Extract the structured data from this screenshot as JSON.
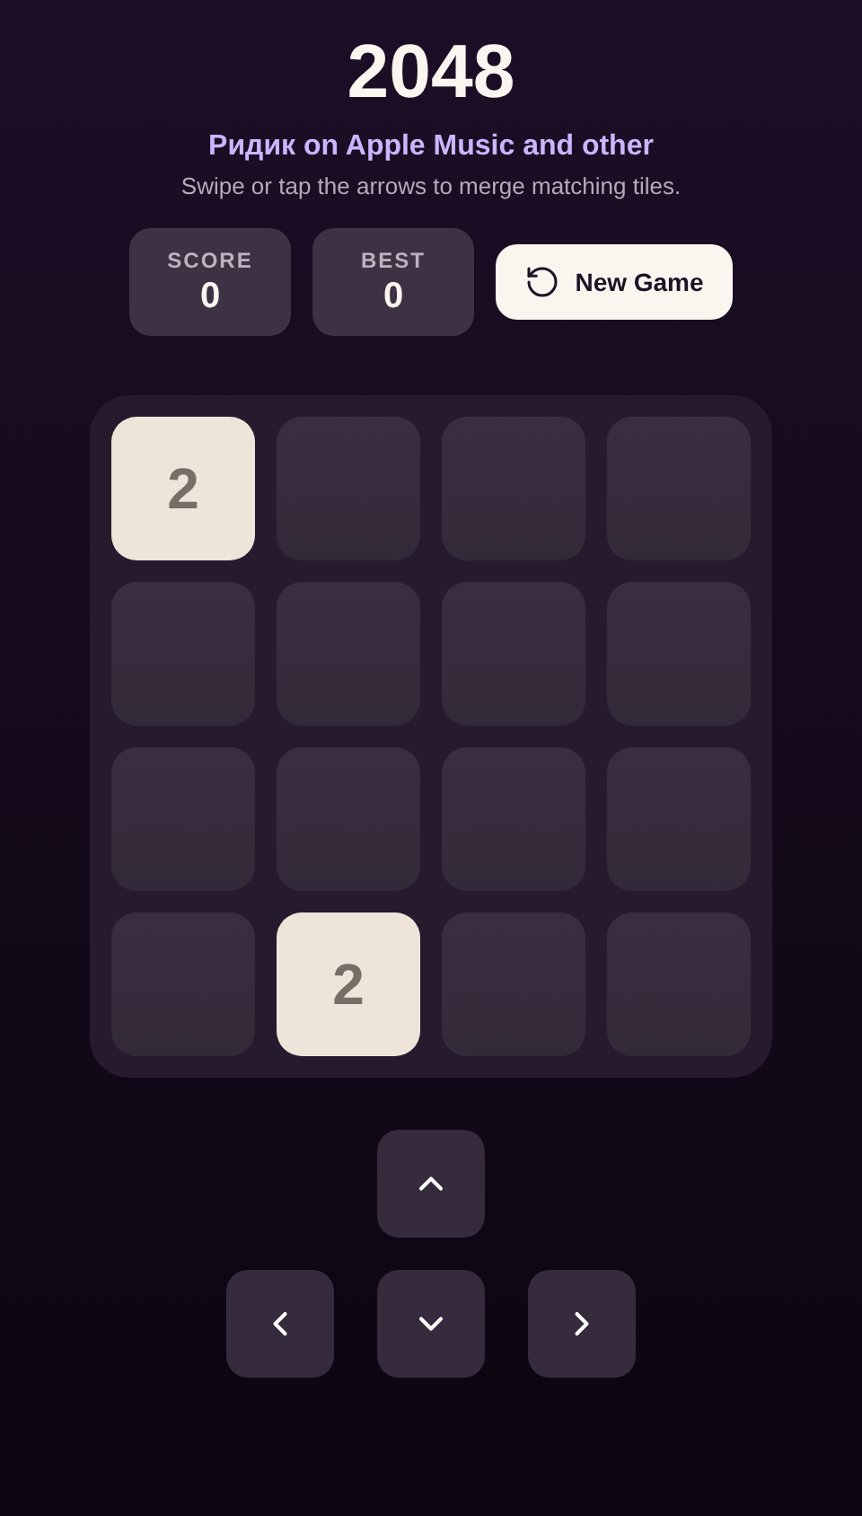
{
  "title": "2048",
  "subtitle": "Ридик on Apple Music and other",
  "instructions": "Swipe or tap the arrows to merge matching tiles.",
  "stats": [
    {
      "label": "SCORE",
      "value": "0"
    },
    {
      "label": "BEST",
      "value": "0"
    }
  ],
  "new_game_button": {
    "label": "New Game"
  },
  "board": {
    "rows": [
      [
        {
          "kind": "tile",
          "value": "2"
        },
        {
          "kind": "empty"
        },
        {
          "kind": "empty"
        },
        {
          "kind": "empty"
        }
      ],
      [
        {
          "kind": "empty"
        },
        {
          "kind": "empty"
        },
        {
          "kind": "empty"
        },
        {
          "kind": "empty"
        }
      ],
      [
        {
          "kind": "empty"
        },
        {
          "kind": "empty"
        },
        {
          "kind": "empty"
        },
        {
          "kind": "empty"
        }
      ],
      [
        {
          "kind": "empty"
        },
        {
          "kind": "tile",
          "value": "2"
        },
        {
          "kind": "empty"
        },
        {
          "kind": "empty"
        }
      ]
    ]
  },
  "arrow_pad": [
    {
      "kind": "up"
    },
    {
      "kind": "left"
    },
    {
      "kind": "down"
    },
    {
      "kind": "right"
    }
  ]
}
